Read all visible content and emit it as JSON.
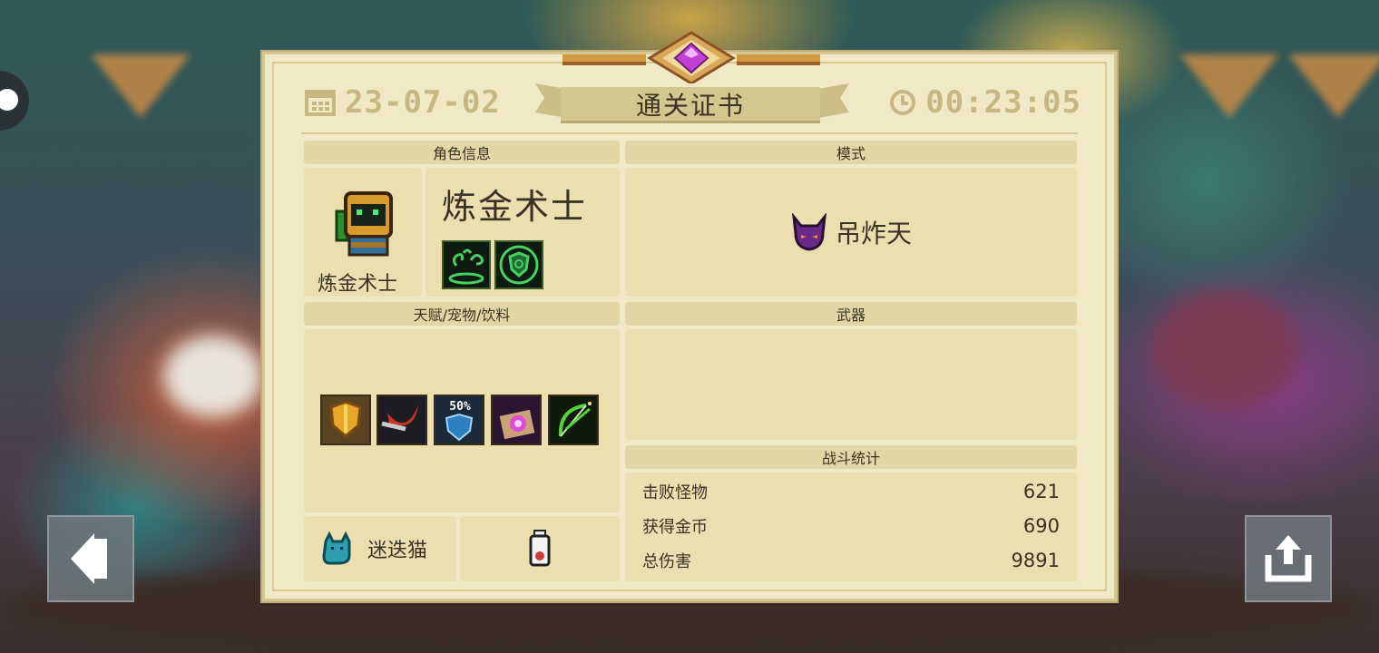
{
  "certificate": {
    "date": "23-07-02",
    "title": "通关证书",
    "time": "00:23:05"
  },
  "character": {
    "section_label": "角色信息",
    "name": "炼金术士",
    "portrait_caption": "炼金术士",
    "skills": [
      "alchemy-swirl-skill-icon",
      "green-shield-skill-icon"
    ]
  },
  "mode": {
    "section_label": "模式",
    "name": "吊炸天",
    "icon": "purple-demon-mask-icon"
  },
  "loadout": {
    "section_label": "天赋/宠物/饮料",
    "talents": [
      {
        "icon": "orange-shield-talent-icon",
        "badge": ""
      },
      {
        "icon": "red-slash-talent-icon",
        "badge": ""
      },
      {
        "icon": "blue-shield-talent-icon",
        "badge": "50%"
      },
      {
        "icon": "magic-scroll-talent-icon",
        "badge": ""
      },
      {
        "icon": "green-bow-talent-icon",
        "badge": ""
      }
    ],
    "pet_name": "迷迭猫",
    "pet_icon": "blue-cat-pet-icon",
    "drink_icon": "milk-bottle-drink-icon"
  },
  "weapons": {
    "section_label": "武器"
  },
  "stats": {
    "section_label": "战斗统计",
    "rows": [
      {
        "label": "击败怪物",
        "value": "621"
      },
      {
        "label": "获得金币",
        "value": "690"
      },
      {
        "label": "总伤害",
        "value": "9891"
      }
    ]
  },
  "colors": {
    "parchment": "#f1e8c6",
    "header": "#e3d6a4",
    "gem": "#c23fd6",
    "gold": "#d39a45"
  }
}
